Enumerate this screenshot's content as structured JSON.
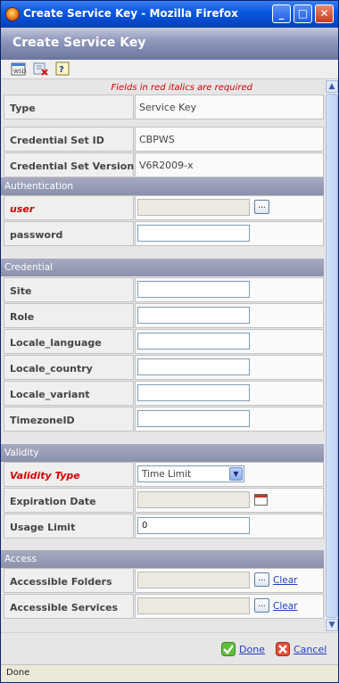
{
  "window": {
    "title": "Create Service Key - Mozilla Firefox"
  },
  "banner": {
    "title": "Create Service Key"
  },
  "toolbar": {
    "icons": [
      "wsdl-icon",
      "delete-icon",
      "help-icon"
    ]
  },
  "form": {
    "required_note": "Fields in red italics are required",
    "type": {
      "label": "Type",
      "value": "Service Key"
    },
    "credential_set_id": {
      "label": "Credential Set ID",
      "value": "CBPWS"
    },
    "credential_set_version": {
      "label": "Credential Set Version",
      "value": "V6R2009-x"
    },
    "authentication": {
      "title": "Authentication",
      "user": {
        "label": "user",
        "value": ""
      },
      "password": {
        "label": "password",
        "value": ""
      }
    },
    "credential": {
      "title": "Credential",
      "site": {
        "label": "Site",
        "value": ""
      },
      "role": {
        "label": "Role",
        "value": ""
      },
      "locale_language": {
        "label": "Locale_language",
        "value": ""
      },
      "locale_country": {
        "label": "Locale_country",
        "value": ""
      },
      "locale_variant": {
        "label": "Locale_variant",
        "value": ""
      },
      "timezone_id": {
        "label": "TimezoneID",
        "value": ""
      }
    },
    "validity": {
      "title": "Validity",
      "validity_type": {
        "label": "Validity Type",
        "selected": "Time Limit"
      },
      "expiration_date": {
        "label": "Expiration Date",
        "value": ""
      },
      "usage_limit": {
        "label": "Usage Limit",
        "value": "0"
      }
    },
    "access": {
      "title": "Access",
      "accessible_folders": {
        "label": "Accessible Folders",
        "value": "",
        "browse": "...",
        "clear": "Clear"
      },
      "accessible_services": {
        "label": "Accessible Services",
        "value": "",
        "browse": "...",
        "clear": "Clear"
      }
    }
  },
  "footer": {
    "done": "Done",
    "cancel": "Cancel"
  },
  "status": {
    "text": "Done"
  },
  "colors": {
    "required": "#d50000",
    "section": "#9499b2",
    "link": "#1f3fbf"
  }
}
